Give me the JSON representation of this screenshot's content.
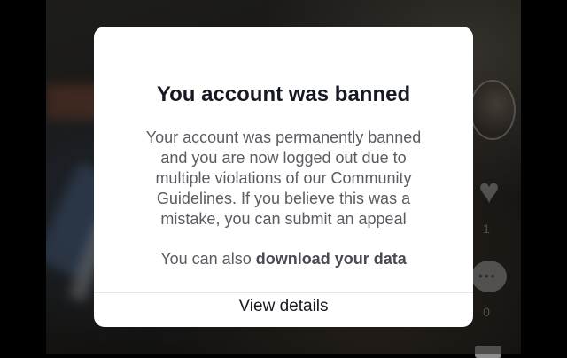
{
  "dialog": {
    "title": "You account was banned",
    "message_lines": [
      "Your account was permanently banned",
      "and you are now logged out due to",
      "multiple violations of our Community",
      "Guidelines. If you believe this was a",
      "mistake, you can submit an appeal"
    ],
    "download_prefix": "You can also ",
    "download_link": "download your data",
    "details_button": "View details"
  },
  "background": {
    "like_count": "1",
    "comment_count": "0",
    "icons": [
      "avatar",
      "heart-icon",
      "comment-icon",
      "share-icon"
    ]
  }
}
